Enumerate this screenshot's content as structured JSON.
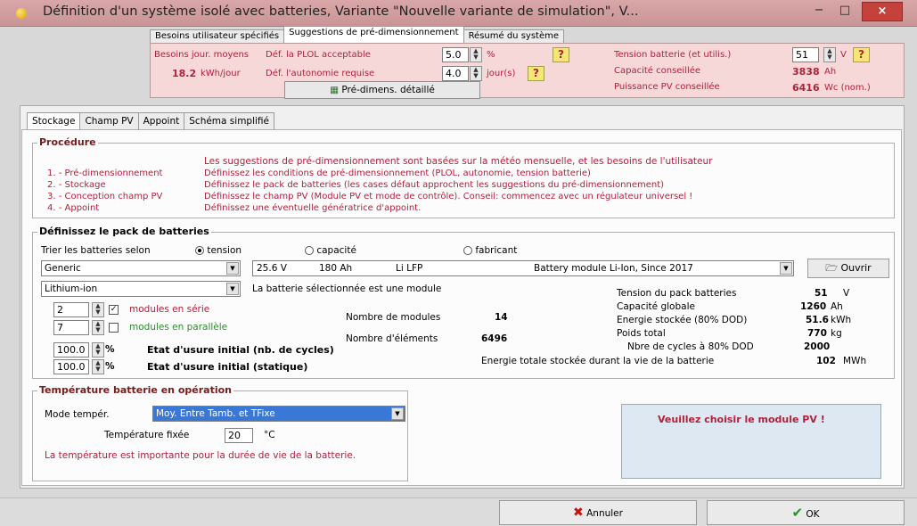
{
  "window": {
    "title": "Définition d'un système isolé avec batteries, Variante   \"Nouvelle variante de simulation\", V...",
    "min": "−",
    "max": "□",
    "close": "×"
  },
  "top_tabs": [
    "Besoins utilisateur spécifiés",
    "Suggestions de pré-dimensionnement",
    "Résumé du système"
  ],
  "predim": {
    "daily_label": "Besoins jour. moyens",
    "daily_value": "18.2",
    "daily_unit": "kWh/jour",
    "plol_label": "Déf. la PLOL acceptable",
    "plol_value": "5.0",
    "plol_unit": "%",
    "autonomy_label": "Déf. l'autonomie requise",
    "autonomy_value": "4.0",
    "autonomy_unit": "jour(s)",
    "help": "?",
    "btn_detail": "Pré-dimens. détaillé",
    "voltage_label": "Tension batterie (et utilis.)",
    "voltage_value": "51",
    "voltage_unit": "V",
    "capacity_label": "Capacité conseillée",
    "capacity_value": "3838",
    "capacity_unit": "Ah",
    "pv_label": "Puissance PV conseillée",
    "pv_value": "6416",
    "pv_unit": "Wc (nom.)"
  },
  "sub_tabs": [
    "Stockage",
    "Champ PV",
    "Appoint",
    "Schéma simplifié"
  ],
  "procedure": {
    "title": "Procédure",
    "intro": "Les suggestions de pré-dimensionnement sont basées sur la météo mensuelle, et les besoins de l'utilisateur",
    "steps": [
      {
        "name": "1. - Pré-dimensionnement",
        "desc": "Définissez les conditions de pré-dimensionnement (PLOL, autonomie, tension batterie)"
      },
      {
        "name": "2. - Stockage",
        "desc": "Définissez le pack de batteries (les cases défaut approchent les suggestions du pré-dimensionnement)"
      },
      {
        "name": "3. - Conception champ PV",
        "desc": "Définissez le champ PV (Module PV et mode de contrôle). Conseil: commencez avec un régulateur universel !"
      },
      {
        "name": "4. - Appoint",
        "desc": "Définissez une éventuelle génératrice d'appoint."
      }
    ]
  },
  "battery": {
    "title": "Définissez le pack de batteries",
    "sort_label": "Trier les batteries selon",
    "sort_options": [
      "tension",
      "capacité",
      "fabricant"
    ],
    "manufacturer": "Generic",
    "model": {
      "voltage": "25.6 V",
      "capacity": "180 Ah",
      "tech": "Li LFP",
      "desc": "Battery module Li-Ion,  Since 2017"
    },
    "open_btn": "Ouvrir",
    "type": "Lithium-ion",
    "is_module_note": "La batterie sélectionnée est une module",
    "series_value": "2",
    "series_label": "modules en série",
    "parallel_value": "7",
    "parallel_label": "modules en parallèle",
    "nb_modules_label": "Nombre de modules",
    "nb_modules_value": "14",
    "nb_elements_label": "Nombre d'éléments",
    "nb_elements_value": "6496",
    "wear_cycles_value": "100.0",
    "wear_cycles_unit": "%",
    "wear_cycles_label": "Etat d'usure initial (nb. de cycles)",
    "wear_static_value": "100.0",
    "wear_static_unit": "%",
    "wear_static_label": "Etat d'usure initial (statique)",
    "stats": [
      {
        "label": "Tension du pack batteries",
        "value": "51",
        "unit": "V"
      },
      {
        "label": "Capacité globale",
        "value": "1260",
        "unit": "Ah"
      },
      {
        "label": "Energie stockée (80% DOD)",
        "value": "51.6",
        "unit": "kWh"
      },
      {
        "label": "Poids total",
        "value": "770",
        "unit": "kg"
      },
      {
        "label": "Nbre de cycles à 80% DOD",
        "value": "2000",
        "unit": ""
      }
    ],
    "lifetime_label": "Energie totale stockée durant la vie de la batterie",
    "lifetime_value": "102",
    "lifetime_unit": "MWh"
  },
  "temperature": {
    "title": "Température batterie en opération",
    "mode_label": "Mode tempér.",
    "mode_value": "Moy. Entre Tamb. et TFixe",
    "fixed_label": "Température fixée",
    "fixed_value": "20",
    "fixed_unit": "°C",
    "note": "La température est importante pour la durée de vie de la batterie."
  },
  "pv_warning": "Veuillez choisir le module PV !",
  "buttons": {
    "cancel": "Annuler",
    "ok": "OK"
  }
}
